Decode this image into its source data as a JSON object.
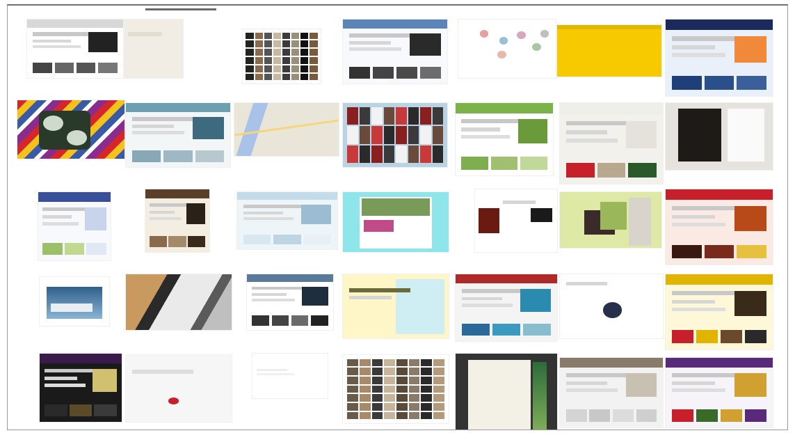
{
  "app": {
    "name": "website-thumbnail-grid"
  },
  "colors": {
    "frame": "#9a9a9a",
    "accent_red": "#c8202b",
    "yellow": "#f7ca00",
    "cyan": "#8ee6ea",
    "navy": "#1b2a5a",
    "lime": "#dfe9a6"
  },
  "thumbnails": [
    {
      "id": "r1c1",
      "style": "news-dark"
    },
    {
      "id": "r1c2",
      "style": "blank-beige"
    },
    {
      "id": "r1c3",
      "style": "photo-mosaic"
    },
    {
      "id": "r1c4",
      "style": "blue-shop"
    },
    {
      "id": "r1c5",
      "style": "dots"
    },
    {
      "id": "r1c6",
      "style": "yellow"
    },
    {
      "id": "r1c7",
      "style": "navy-portal"
    },
    {
      "id": "r2c1",
      "style": "stripes"
    },
    {
      "id": "r2c2",
      "style": "teal-portal"
    },
    {
      "id": "r2c3",
      "style": "map"
    },
    {
      "id": "r2c4",
      "style": "lightblue-collage"
    },
    {
      "id": "r2c5",
      "style": "green-list"
    },
    {
      "id": "r2c6",
      "style": "gallery-red"
    },
    {
      "id": "r2c7",
      "style": "portrait"
    },
    {
      "id": "r3c1",
      "style": "blue-nav-list"
    },
    {
      "id": "r3c2",
      "style": "brown-feature"
    },
    {
      "id": "r3c3",
      "style": "pale-blue-page"
    },
    {
      "id": "r3c4",
      "style": "cyan-frame"
    },
    {
      "id": "r3c5",
      "style": "sparse-red"
    },
    {
      "id": "r3c6",
      "style": "lime-banner"
    },
    {
      "id": "r3c7",
      "style": "red-magazine"
    },
    {
      "id": "r4c1",
      "style": "boats"
    },
    {
      "id": "r4c2",
      "style": "architecture"
    },
    {
      "id": "r4c3",
      "style": "catalog"
    },
    {
      "id": "r4c4",
      "style": "yellow-cyan-text"
    },
    {
      "id": "r4c5",
      "style": "travel-red"
    },
    {
      "id": "r4c6",
      "style": "circle-logo"
    },
    {
      "id": "r4c7",
      "style": "yellow-magazine"
    },
    {
      "id": "r5c1",
      "style": "dark-purple"
    },
    {
      "id": "r5c2",
      "style": "sparse-map"
    },
    {
      "id": "r5c3",
      "style": "blank-white"
    },
    {
      "id": "r5c4",
      "style": "faces-mosaic"
    },
    {
      "id": "r5c5",
      "style": "wedding-card"
    },
    {
      "id": "r5c6",
      "style": "gray-calendar"
    },
    {
      "id": "r5c7",
      "style": "purple-store"
    }
  ]
}
